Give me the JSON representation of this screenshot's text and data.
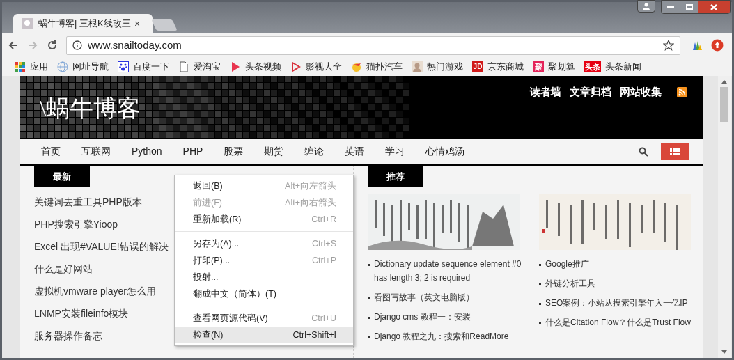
{
  "tab": {
    "title": "蜗牛博客| 三根K线改三",
    "close": "×"
  },
  "address": {
    "url": "www.snailtoday.com"
  },
  "bookmarks": [
    {
      "label": "应用",
      "kind": "apps"
    },
    {
      "label": "网址导航",
      "kind": "globe"
    },
    {
      "label": "百度一下",
      "kind": "paw"
    },
    {
      "label": "爱淘宝",
      "kind": "page"
    },
    {
      "label": "头条视频",
      "kind": "play"
    },
    {
      "label": "影视大全",
      "kind": "video"
    },
    {
      "label": "猫扑汽车",
      "kind": "mascot"
    },
    {
      "label": "热门游戏",
      "kind": "avatar"
    },
    {
      "label": "京东商城",
      "kind": "jd",
      "badge": "JD"
    },
    {
      "label": "聚划算",
      "kind": "ju",
      "badge": "聚"
    },
    {
      "label": "头条新闻",
      "kind": "toutiao",
      "badge": "头条"
    }
  ],
  "site": {
    "logo": "\\蜗牛博客",
    "top_links": [
      "读者墙",
      "文章归档",
      "网站收集"
    ]
  },
  "nav": [
    "首页",
    "互联网",
    "Python",
    "PHP",
    "股票",
    "期货",
    "缠论",
    "英语",
    "学习",
    "心情鸡汤"
  ],
  "latest": {
    "heading": "最新",
    "items": [
      "关键词去重工具PHP版本",
      "PHP搜索引擎Yioop",
      "Excel 出现#VALUE!错误的解决",
      "什么是好网站",
      "虚拟机vmware player怎么用",
      "LNMP安装fileinfo模块",
      "服务器操作备忘"
    ]
  },
  "recommended": {
    "heading": "推荐",
    "columns": [
      {
        "items": [
          "Dictionary update sequence element #0 has length 3; 2 is required",
          "看图写故事（英文电脑版）",
          "Django cms 教程一：安装",
          "Django 教程之九：搜索和ReadMore"
        ]
      },
      {
        "items": [
          "Google推广",
          "外链分析工具",
          "SEO案例：小站从搜索引擎年入一亿IP",
          "什么是Citation Flow？什么是Trust Flow"
        ]
      }
    ]
  },
  "context_menu": [
    {
      "kind": "item",
      "label": "返回(B)",
      "shortcut": "Alt+向左箭头",
      "disabled": false,
      "selected": false
    },
    {
      "kind": "item",
      "label": "前进(F)",
      "shortcut": "Alt+向右箭头",
      "disabled": true,
      "selected": false
    },
    {
      "kind": "item",
      "label": "重新加载(R)",
      "shortcut": "Ctrl+R",
      "disabled": false,
      "selected": false
    },
    {
      "kind": "separator"
    },
    {
      "kind": "item",
      "label": "另存为(A)...",
      "shortcut": "Ctrl+S",
      "disabled": false,
      "selected": false
    },
    {
      "kind": "item",
      "label": "打印(P)...",
      "shortcut": "Ctrl+P",
      "disabled": false,
      "selected": false
    },
    {
      "kind": "item",
      "label": "投射...",
      "disabled": false,
      "selected": false
    },
    {
      "kind": "item",
      "label": "翻成中文（简体）(T)",
      "disabled": false,
      "selected": false
    },
    {
      "kind": "separator"
    },
    {
      "kind": "item",
      "label": "查看网页源代码(V)",
      "shortcut": "Ctrl+U",
      "disabled": false,
      "selected": false
    },
    {
      "kind": "item",
      "label": "检查(N)",
      "shortcut": "Ctrl+Shift+I",
      "disabled": false,
      "selected": true
    }
  ]
}
